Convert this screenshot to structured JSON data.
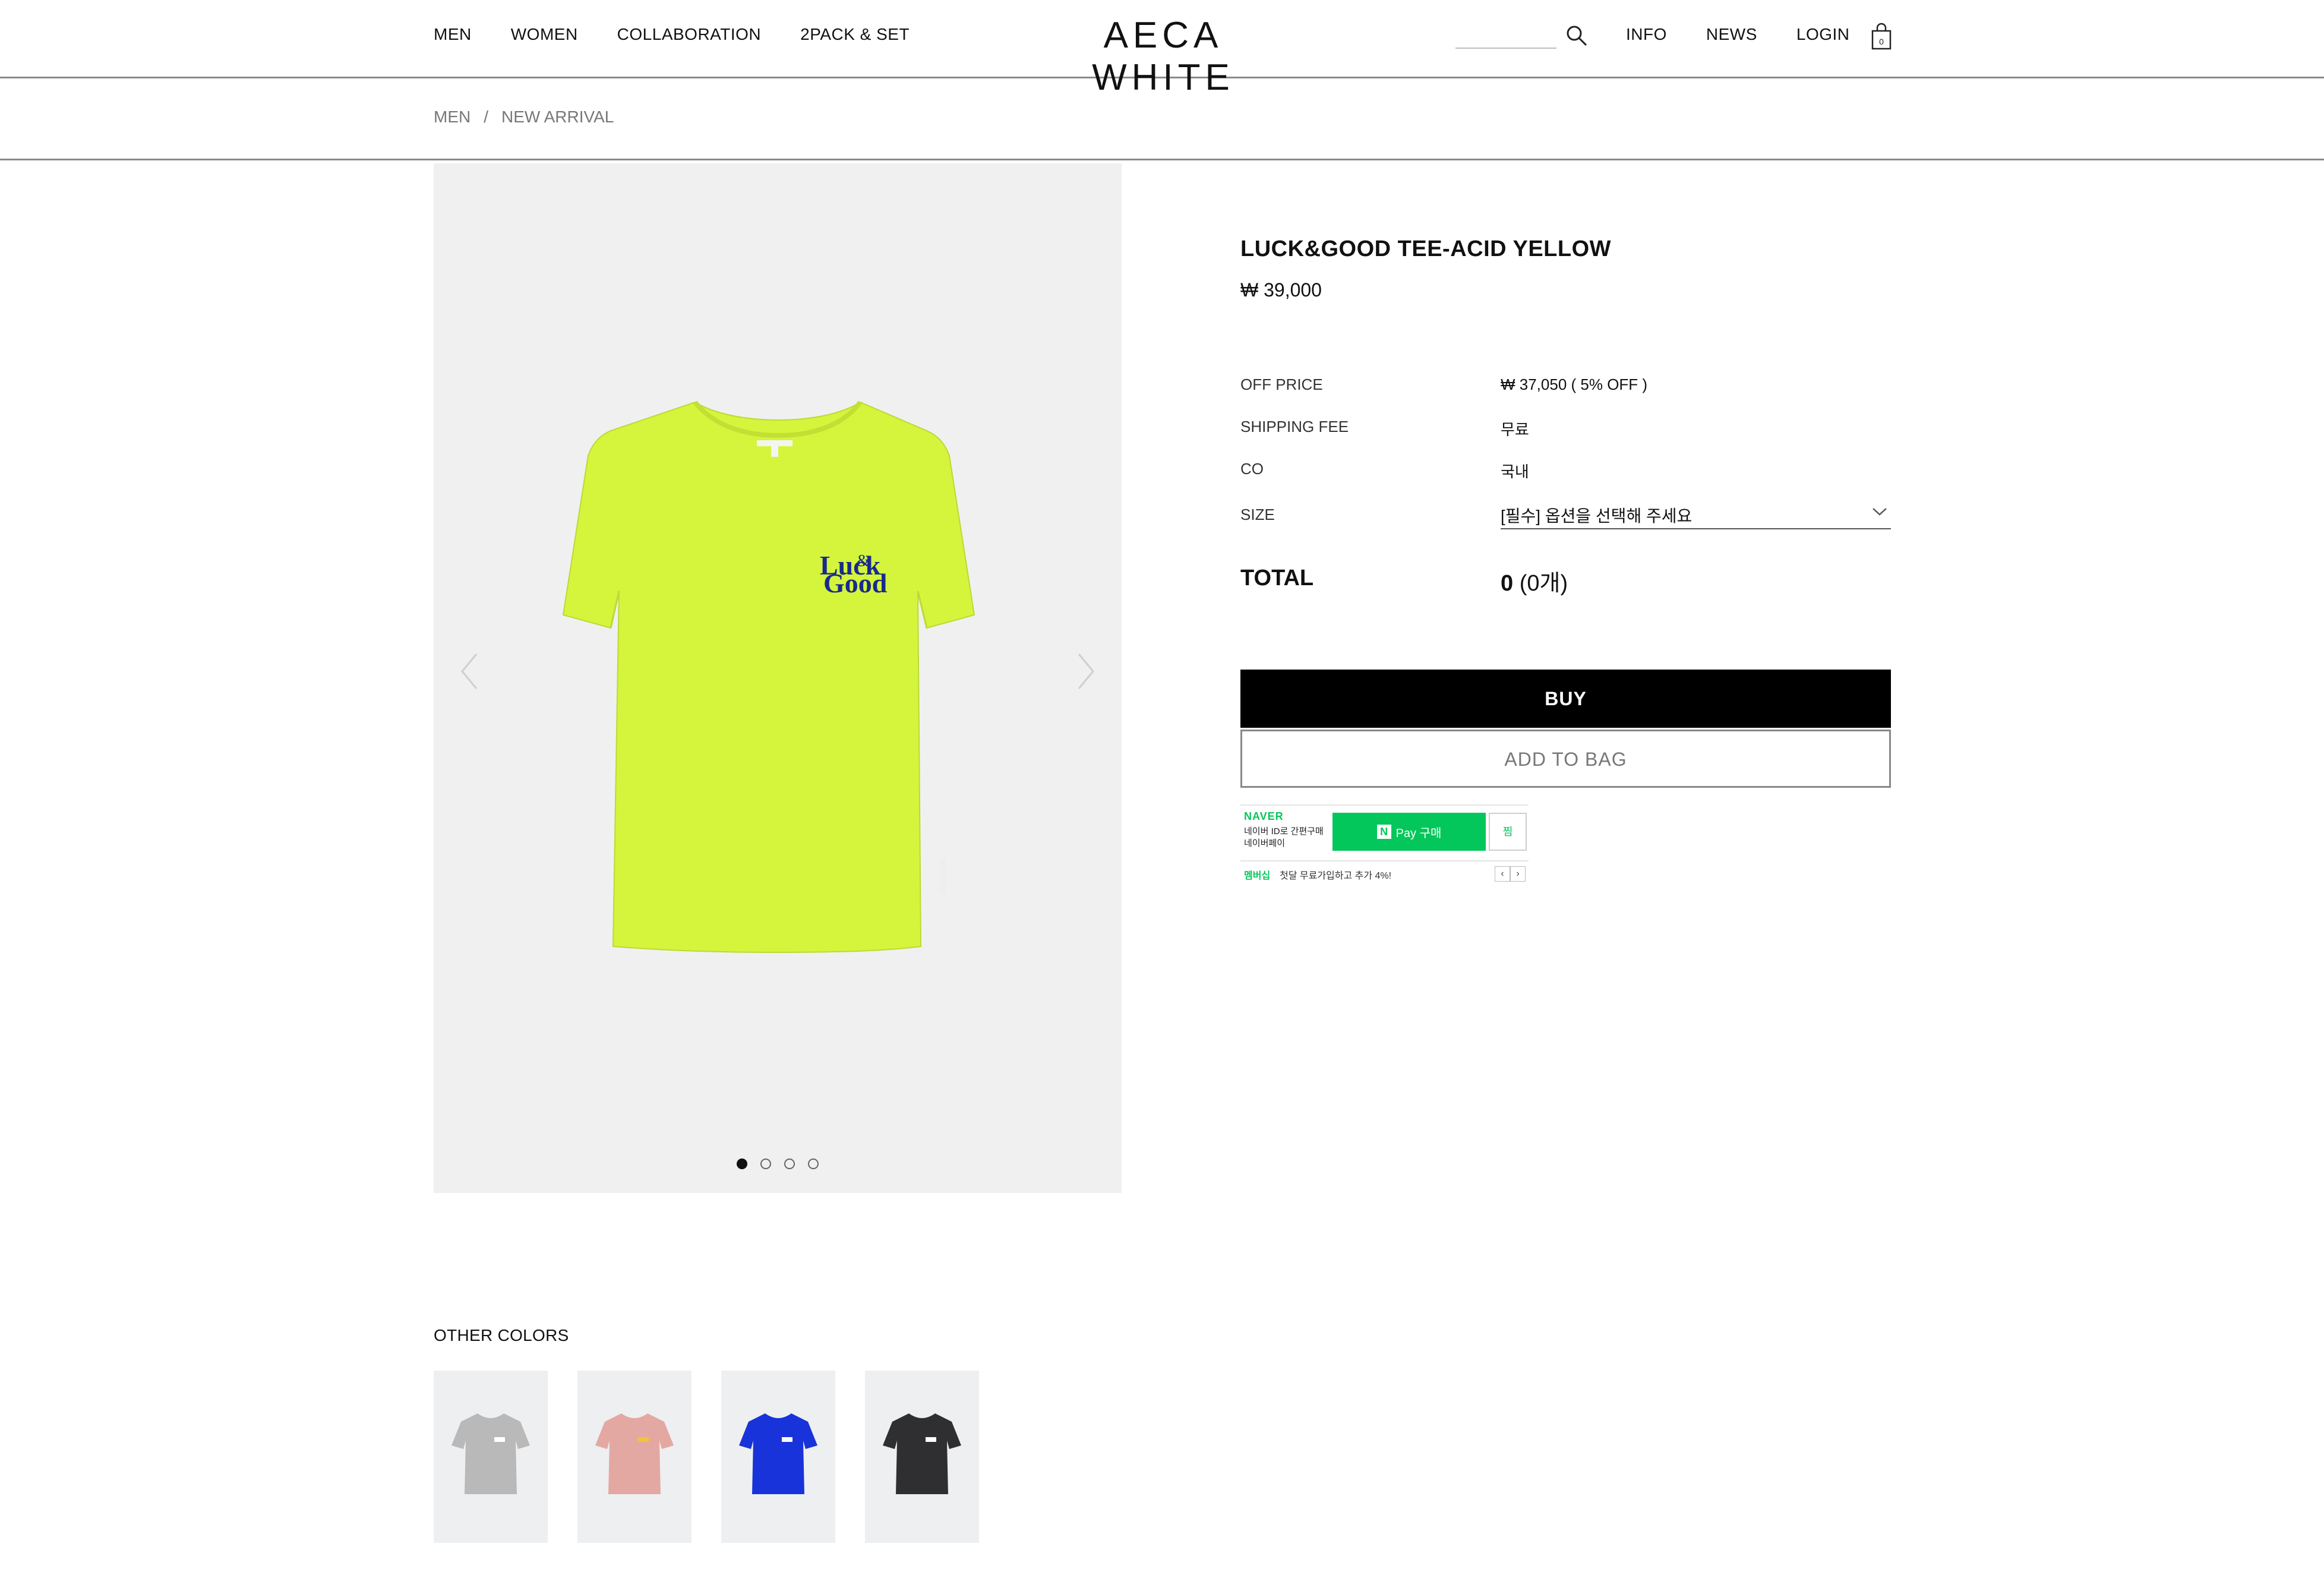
{
  "header": {
    "nav_left": [
      "MEN",
      "WOMEN",
      "COLLABORATION",
      "2PACK & SET"
    ],
    "logo": "AECA WHITE",
    "search_placeholder": "",
    "nav_right": [
      "INFO",
      "NEWS",
      "LOGIN"
    ],
    "bag_count": "0"
  },
  "breadcrumb": {
    "items": [
      "MEN",
      "NEW ARRIVAL"
    ],
    "separator": "/"
  },
  "gallery": {
    "slide_count": 4,
    "active_index": 0,
    "print_text_line1": "Luck",
    "print_text_line2": "Good",
    "print_amp": "&",
    "shirt_color": "#d4f53c",
    "print_color": "#1a2a8c"
  },
  "product": {
    "name": "LUCK&GOOD TEE-ACID YELLOW",
    "price": "₩ 39,000",
    "rows": [
      {
        "key": "OFF PRICE",
        "value": "₩ 37,050 ( 5% OFF )"
      },
      {
        "key": "SHIPPING FEE",
        "value": "무료"
      },
      {
        "key": "CO",
        "value": "국내"
      }
    ],
    "size_label": "SIZE",
    "size_placeholder": "[필수] 옵션을 선택해 주세요",
    "total_label": "TOTAL",
    "total_value": "0",
    "total_count": "(0개)",
    "buy_label": "BUY",
    "add_to_bag_label": "ADD TO BAG"
  },
  "naver_pay": {
    "brand": "NAVER",
    "sub1": "네이버 ID로 간편구매",
    "sub2": "네이버페이",
    "pay_label": "Pay 구매",
    "n_letter": "N",
    "zzim": "찜",
    "membership": "멤버십",
    "membership_text": "첫달 무료가입하고 추가 4%!",
    "prev": "‹",
    "next": "›"
  },
  "other_colors": {
    "title": "OTHER COLORS",
    "swatches": [
      {
        "name": "grey",
        "color": "#b9b9b9",
        "print": "#ffffff"
      },
      {
        "name": "pink",
        "color": "#e4a8a2",
        "print": "#f3c23a"
      },
      {
        "name": "blue",
        "color": "#1733d9",
        "print": "#ffffff"
      },
      {
        "name": "black",
        "color": "#2f2f31",
        "print": "#ffffff"
      }
    ]
  },
  "colors": {
    "accent_black": "#000000",
    "naver_green": "#03c75a",
    "divider": "#8a8a8a"
  }
}
